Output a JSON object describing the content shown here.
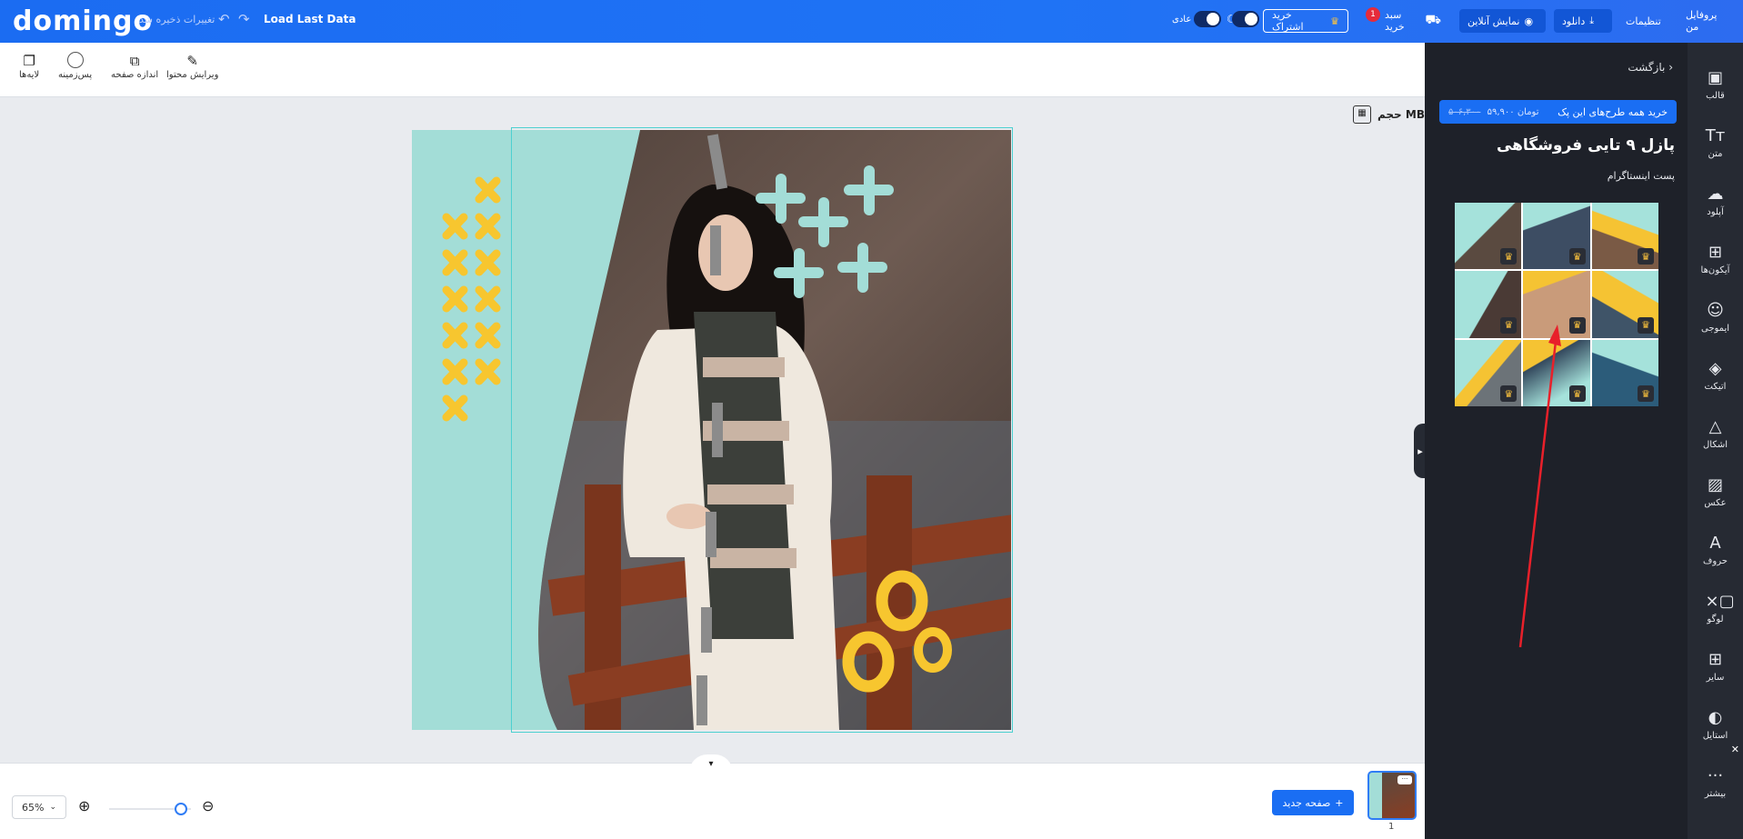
{
  "topbar": {
    "logo": "domingo",
    "saved_text": "تغییرات ذخیره شد",
    "load_last": "Load Last Data",
    "mode_label": "عادی",
    "subscribe_label": "خرید اشتراک",
    "cart_label": "سبد خرید",
    "cart_count": "1",
    "preview_label": "نمایش آنلاین",
    "download_label": "دانلود",
    "settings_label": "تنظیمات",
    "profile_label": "پروفایل من"
  },
  "toolbar": {
    "edit_content": "ویرایش محتوا",
    "page_size": "اندازه صفحه",
    "background": "پس‌زمینه",
    "layers": "لایه‌ها"
  },
  "canvas": {
    "size_label": "حجم MB"
  },
  "panel": {
    "back_label": "بازگشت",
    "buy_all_label": "خرید همه طرح‌های این پک",
    "buy_all_price": "۵۹,۹۰۰ تومان",
    "buy_all_old_price": "۵۰۶,۳۰۰",
    "title": "پازل ۹ تایی فروشگاهی",
    "subtitle": "پست اینستاگرام"
  },
  "sidebar": {
    "items": [
      {
        "label": "قالب",
        "icon": "template-icon"
      },
      {
        "label": "متن",
        "icon": "text-icon"
      },
      {
        "label": "آپلود",
        "icon": "upload-icon"
      },
      {
        "label": "آیکون‌ها",
        "icon": "icons-icon"
      },
      {
        "label": "ایموجی",
        "icon": "emoji-icon"
      },
      {
        "label": "اتیکت",
        "icon": "tag-icon"
      },
      {
        "label": "اشکال",
        "icon": "shapes-icon"
      },
      {
        "label": "عکس",
        "icon": "photo-icon"
      },
      {
        "label": "حروف",
        "icon": "letters-icon"
      },
      {
        "label": "لوگو",
        "icon": "logo-icon"
      },
      {
        "label": "سایر",
        "icon": "other-icon"
      },
      {
        "label": "استایل",
        "icon": "style-icon"
      },
      {
        "label": "بیشتر",
        "icon": "more-icon"
      }
    ]
  },
  "bottombar": {
    "zoom_value": "65%",
    "new_page": "صفحه جدید",
    "page_number": "1"
  },
  "colors": {
    "primary": "#1a6ef3",
    "canvas_mint": "#a3ddd7",
    "accent_yellow": "#f7c62f",
    "panel_bg": "#1e2129",
    "sidebar_bg": "#262a33"
  }
}
